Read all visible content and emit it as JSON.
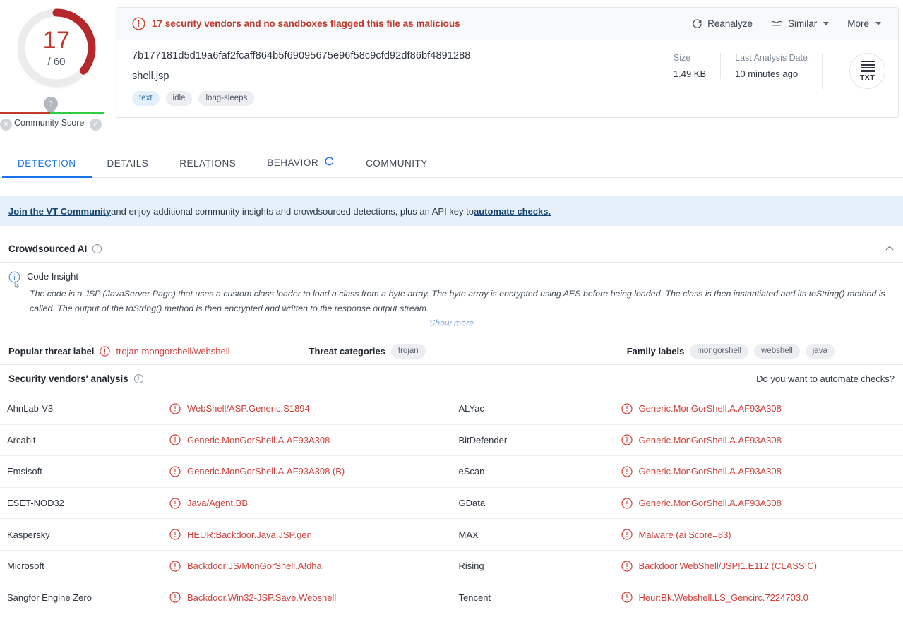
{
  "score": {
    "detections": "17",
    "total": "/ 60"
  },
  "community": {
    "label": "Community Score",
    "negative_icon": "×",
    "positive_icon": "✓",
    "pin_icon": "?"
  },
  "header": {
    "verdict": "17 security vendors and no sandboxes flagged this file as malicious",
    "warning_icon": "warning-circle-icon",
    "actions": [
      {
        "label": "Reanalyze",
        "icon": "reanalyze-icon",
        "caret": false
      },
      {
        "label": "Similar",
        "icon": "similar-icon",
        "caret": true
      },
      {
        "label": "More",
        "icon": "",
        "caret": true
      }
    ]
  },
  "file": {
    "hash": "7b177181d5d19a6faf2fcaff864b5f69095675e96f58c9cfd92df86bf4891288",
    "name": "shell.jsp",
    "tags": [
      {
        "label": "text",
        "style": "blue"
      },
      {
        "label": "idle",
        "style": "grey"
      },
      {
        "label": "long-sleeps",
        "style": "grey"
      }
    ],
    "meta": [
      {
        "key": "Size",
        "value": "1.49 KB"
      },
      {
        "key": "Last Analysis Date",
        "value": "10 minutes ago"
      }
    ],
    "filetype_label": "TXT"
  },
  "tabs": [
    {
      "label": "DETECTION",
      "active": true,
      "spinner": false
    },
    {
      "label": "DETAILS",
      "active": false,
      "spinner": false
    },
    {
      "label": "RELATIONS",
      "active": false,
      "spinner": false
    },
    {
      "label": "BEHAVIOR",
      "active": false,
      "spinner": true
    },
    {
      "label": "COMMUNITY",
      "active": false,
      "spinner": false
    }
  ],
  "banner": {
    "link1": "Join the VT Community",
    "middle": " and enjoy additional community insights and crowdsourced detections, plus an API key to ",
    "link2": "automate checks."
  },
  "crowdsourced_ai": {
    "title": "Crowdsourced AI",
    "info_icon": "info-icon",
    "collapse_icon": "chevron-up-icon",
    "insight_title": "Code Insight",
    "insight_text": "The code is a JSP (JavaServer Page) that uses a custom class loader to load a class from a byte array. The byte array is encrypted using AES before being loaded. The class is then instantiated and its toString() method is called. The output of the toString() method is then encrypted and written to the response output stream.",
    "show_more": "Show more"
  },
  "threat": {
    "popular_label_key": "Popular threat label",
    "popular_label_value": "trojan.mongorshell/webshell",
    "categories_key": "Threat categories",
    "categories": [
      "trojan"
    ],
    "family_key": "Family labels",
    "family_labels": [
      "mongorshell",
      "webshell",
      "java"
    ]
  },
  "vendors_section": {
    "title": "Security vendors' analysis",
    "info_icon": "info-icon",
    "automate_link": "Do you want to automate checks?"
  },
  "vendors": [
    {
      "name": "AhnLab-V3",
      "result": "WebShell/ASP.Generic.S1894"
    },
    {
      "name": "ALYac",
      "result": "Generic.MonGorShell.A.AF93A308"
    },
    {
      "name": "Arcabit",
      "result": "Generic.MonGorShell.A.AF93A308"
    },
    {
      "name": "BitDefender",
      "result": "Generic.MonGorShell.A.AF93A308"
    },
    {
      "name": "Emsisoft",
      "result": "Generic.MonGorShell.A.AF93A308 (B)"
    },
    {
      "name": "eScan",
      "result": "Generic.MonGorShell.A.AF93A308"
    },
    {
      "name": "ESET-NOD32",
      "result": "Java/Agent.BB"
    },
    {
      "name": "GData",
      "result": "Generic.MonGorShell.A.AF93A308"
    },
    {
      "name": "Kaspersky",
      "result": "HEUR:Backdoor.Java.JSP.gen"
    },
    {
      "name": "MAX",
      "result": "Malware (ai Score=83)"
    },
    {
      "name": "Microsoft",
      "result": "Backdoor:JS/MonGorShell.A!dha"
    },
    {
      "name": "Rising",
      "result": "Backdoor.WebShell/JSP!1.E112 (CLASSIC)"
    },
    {
      "name": "Sangfor Engine Zero",
      "result": "Backdoor.Win32-JSP.Save.Webshell"
    },
    {
      "name": "Tencent",
      "result": "Heur:Bk.Webshell.LS_Gencirc.7224703.0"
    },
    {
      "name": "",
      "result": ""
    },
    {
      "name": "",
      "result": ""
    }
  ],
  "colors": {
    "malicious_red": "#d0403a",
    "accent_blue": "#1a73e8",
    "gauge_red": "#c0392b",
    "banner_blue": "#e6f0fb"
  }
}
